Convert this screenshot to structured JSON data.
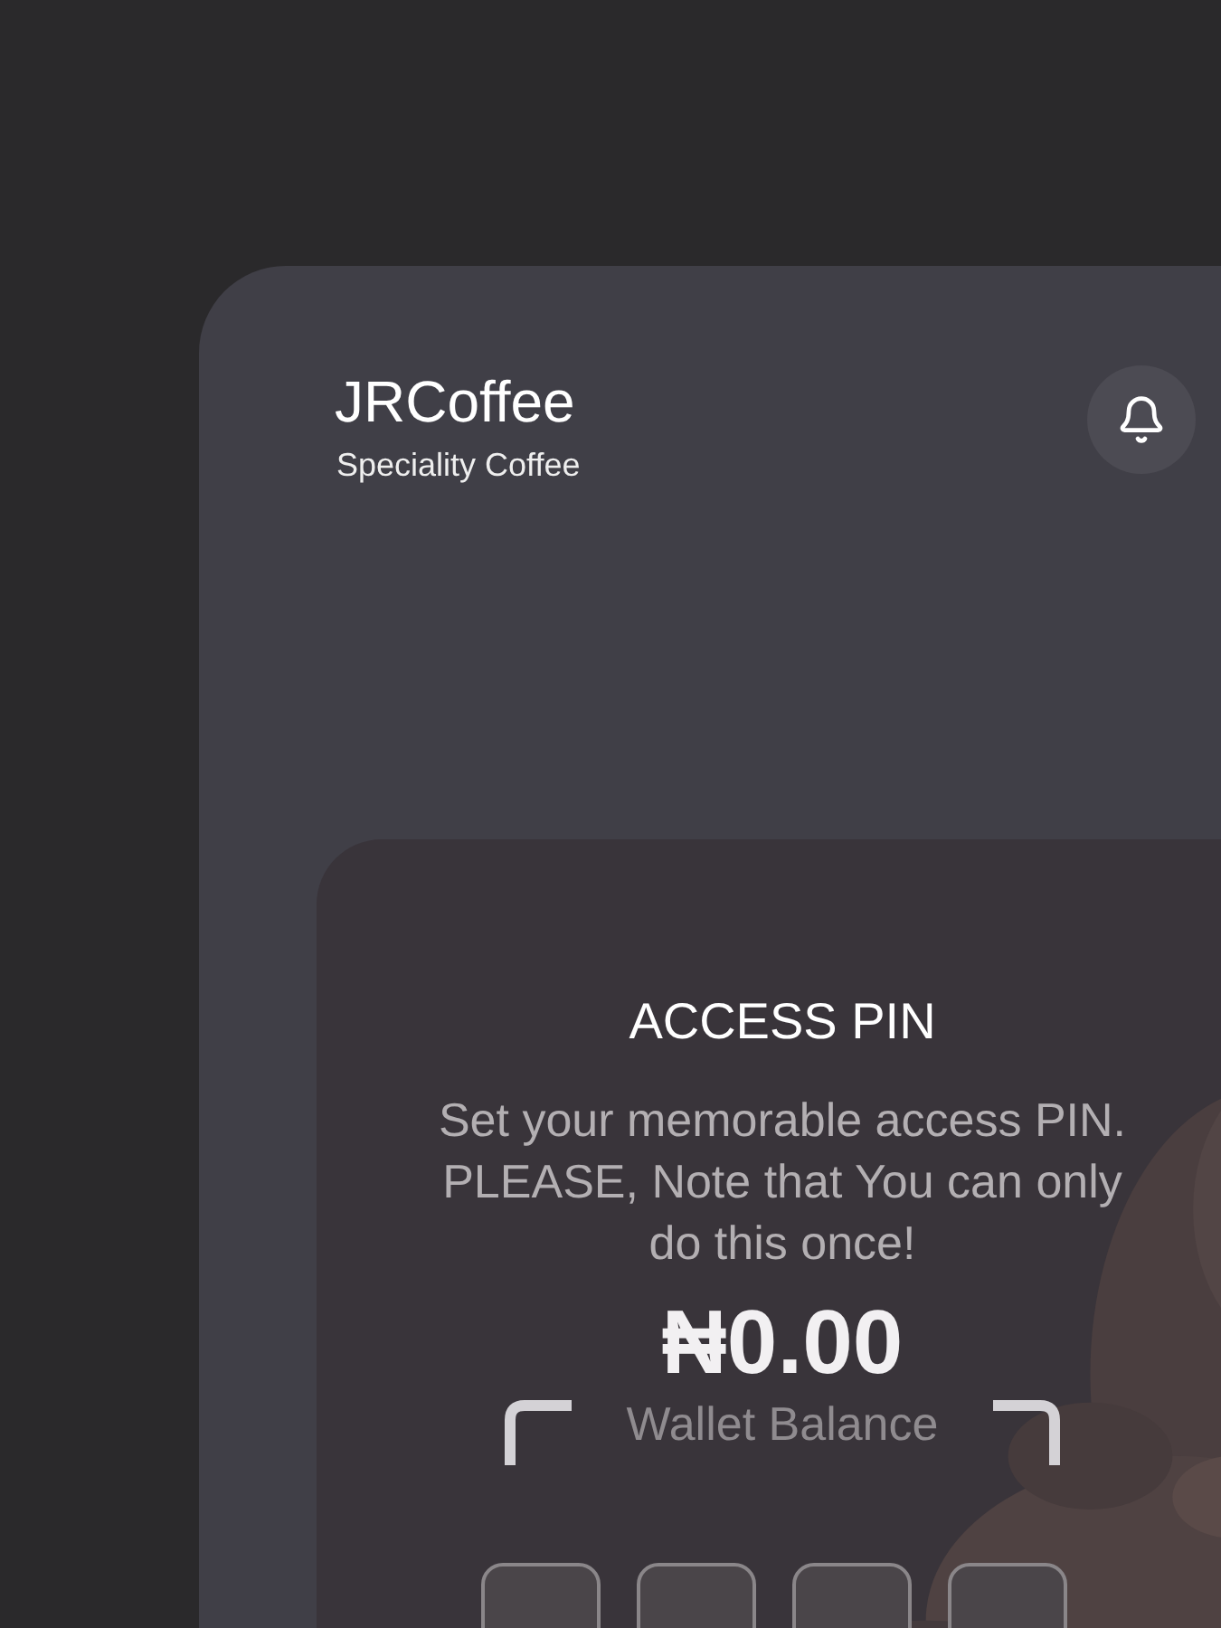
{
  "header": {
    "title": "JRCoffee",
    "subtitle": "Speciality Coffee"
  },
  "pin_card": {
    "kind": "picture",
    "title": "ACCESS PIN",
    "message": "Set your memorable access PIN. PLEASE, Note that You can only do this once!",
    "balance": "₦0.00",
    "balance_label": "Wallet Balance",
    "pin_fields": [
      {
        "filled": false
      },
      {
        "filled": false
      },
      {
        "filled": false
      },
      {
        "filled": false
      }
    ]
  }
}
